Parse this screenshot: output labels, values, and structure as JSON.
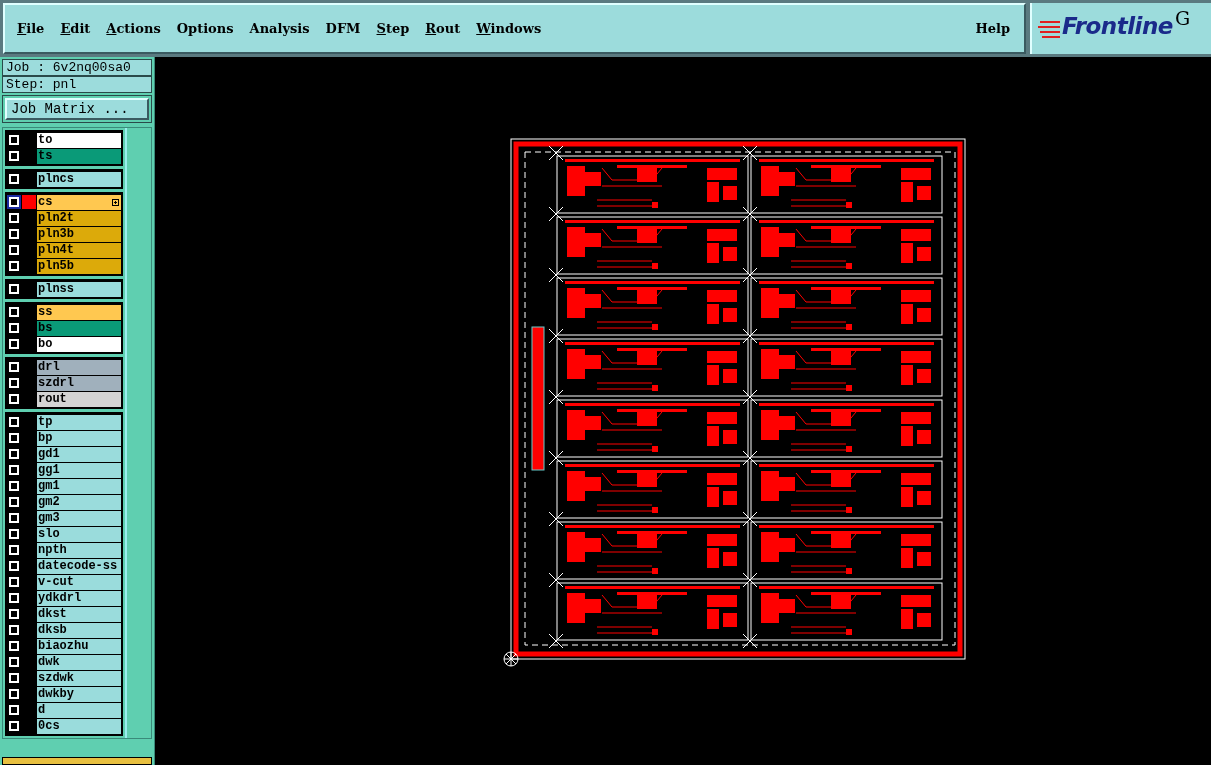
{
  "menu": [
    {
      "label": "File",
      "underlined": true
    },
    {
      "label": "Edit",
      "underlined": true
    },
    {
      "label": "Actions",
      "underlined": true
    },
    {
      "label": "Options",
      "underlined": false
    },
    {
      "label": "Analysis",
      "underlined": false
    },
    {
      "label": "DFM",
      "underlined": false
    },
    {
      "label": "Step",
      "underlined": true
    },
    {
      "label": "Rout",
      "underlined": true
    },
    {
      "label": "Windows",
      "underlined": true
    }
  ],
  "help": "Help",
  "logo": {
    "name": "Frontline",
    "suffix": "G"
  },
  "job": "Job : 6v2nq00sa0",
  "step": "Step: pnl",
  "job_matrix_button": "Job Matrix ...",
  "layer_groups": [
    [
      {
        "name": "to",
        "color": "#ffffff",
        "checked": false,
        "active": false
      },
      {
        "name": "ts",
        "color": "#0a9a78",
        "checked": false,
        "active": false
      }
    ],
    [
      {
        "name": "plncs",
        "color": "#9adcdc",
        "checked": false,
        "active": false
      }
    ],
    [
      {
        "name": "cs",
        "color": "#ffc850",
        "checked": false,
        "active": true
      },
      {
        "name": "pln2t",
        "color": "#dcaa0a",
        "checked": false,
        "active": false
      },
      {
        "name": "pln3b",
        "color": "#dcaa0a",
        "checked": false,
        "active": false
      },
      {
        "name": "pln4t",
        "color": "#dcaa0a",
        "checked": false,
        "active": false
      },
      {
        "name": "pln5b",
        "color": "#dcaa0a",
        "checked": false,
        "active": false
      }
    ],
    [
      {
        "name": "plnss",
        "color": "#9adcdc",
        "checked": false,
        "active": false
      }
    ],
    [
      {
        "name": "ss",
        "color": "#ffc850",
        "checked": false,
        "active": false
      },
      {
        "name": "bs",
        "color": "#0a9a78",
        "checked": false,
        "active": false
      },
      {
        "name": "bo",
        "color": "#ffffff",
        "checked": false,
        "active": false
      }
    ],
    [
      {
        "name": "drl",
        "color": "#a0b0bc",
        "checked": false,
        "active": false
      },
      {
        "name": "szdrl",
        "color": "#a0b0bc",
        "checked": false,
        "active": false
      },
      {
        "name": "rout",
        "color": "#d4d4d4",
        "checked": false,
        "active": false
      }
    ],
    [
      {
        "name": "tp",
        "color": "#9adcdc",
        "checked": false,
        "active": false
      },
      {
        "name": "bp",
        "color": "#9adcdc",
        "checked": false,
        "active": false
      },
      {
        "name": "gd1",
        "color": "#9adcdc",
        "checked": false,
        "active": false
      },
      {
        "name": "gg1",
        "color": "#9adcdc",
        "checked": false,
        "active": false
      },
      {
        "name": "gm1",
        "color": "#9adcdc",
        "checked": false,
        "active": false
      },
      {
        "name": "gm2",
        "color": "#9adcdc",
        "checked": false,
        "active": false
      },
      {
        "name": "gm3",
        "color": "#9adcdc",
        "checked": false,
        "active": false
      },
      {
        "name": "slo",
        "color": "#9adcdc",
        "checked": false,
        "active": false
      },
      {
        "name": "npth",
        "color": "#9adcdc",
        "checked": false,
        "active": false
      },
      {
        "name": "datecode-ss",
        "color": "#9adcdc",
        "checked": false,
        "active": false
      },
      {
        "name": "v-cut",
        "color": "#9adcdc",
        "checked": false,
        "active": false
      },
      {
        "name": "ydkdrl",
        "color": "#9adcdc",
        "checked": false,
        "active": false
      },
      {
        "name": "dkst",
        "color": "#9adcdc",
        "checked": false,
        "active": false
      },
      {
        "name": "dksb",
        "color": "#9adcdc",
        "checked": false,
        "active": false
      },
      {
        "name": "biaozhu",
        "color": "#9adcdc",
        "checked": false,
        "active": false
      },
      {
        "name": "dwk",
        "color": "#9adcdc",
        "checked": false,
        "active": false
      },
      {
        "name": "szdwk",
        "color": "#9adcdc",
        "checked": false,
        "active": false
      },
      {
        "name": "dwkby",
        "color": "#9adcdc",
        "checked": false,
        "active": false
      },
      {
        "name": "d",
        "color": "#9adcdc",
        "checked": false,
        "active": false
      },
      {
        "name": "0cs",
        "color": "#9adcdc",
        "checked": false,
        "active": false
      }
    ]
  ]
}
